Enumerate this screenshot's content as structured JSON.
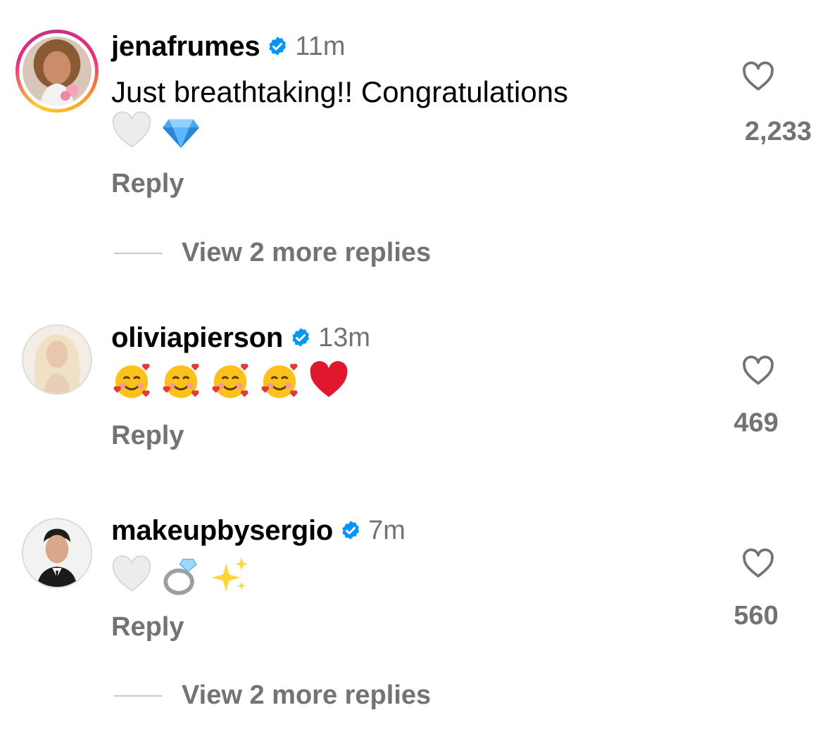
{
  "comments": [
    {
      "username": "jenafrumes",
      "verified": true,
      "time": "11m",
      "text": "Just breathtaking!! Congratulations",
      "emojis": [
        "white-heart",
        "gem"
      ],
      "reply_label": "Reply",
      "view_more": "View 2 more replies",
      "like_count": "2,233",
      "has_story": true
    },
    {
      "username": "oliviapierson",
      "verified": true,
      "time": "13m",
      "text": "",
      "emojis": [
        "smiling-face-with-hearts",
        "smiling-face-with-hearts",
        "smiling-face-with-hearts",
        "smiling-face-with-hearts",
        "red-heart"
      ],
      "reply_label": "Reply",
      "like_count": "469",
      "has_story": false
    },
    {
      "username": "makeupbysergio",
      "verified": true,
      "time": "7m",
      "text": "",
      "emojis": [
        "white-heart",
        "ring",
        "sparkles"
      ],
      "reply_label": "Reply",
      "view_more": "View 2 more replies",
      "like_count": "560",
      "has_story": false
    }
  ],
  "colors": {
    "verified_blue": "#0095f6",
    "secondary_text": "#737373",
    "divider": "#c7c7c7"
  }
}
